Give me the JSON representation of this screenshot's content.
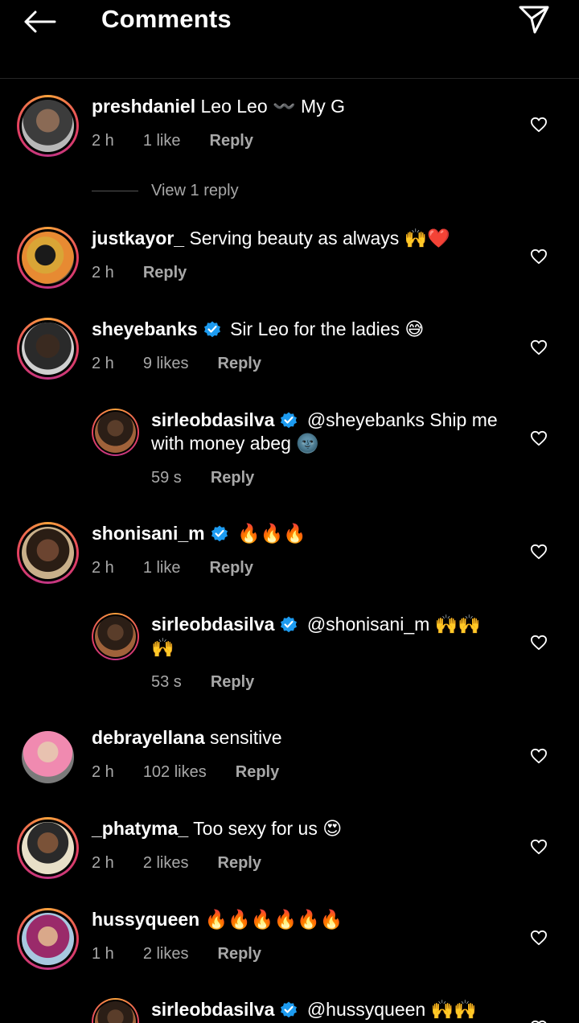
{
  "header": {
    "title": "Comments"
  },
  "colors": {
    "background": "#000000",
    "secondary_text": "#a8a8a8",
    "verified_blue": "#1d9bf0"
  },
  "comments": [
    {
      "user": "preshdaniel",
      "text": "Leo Leo 〰️ My G",
      "time": "2 h",
      "likes": "1 like",
      "reply_label": "Reply",
      "view_replies": "View 1 reply"
    },
    {
      "user": "justkayor_",
      "text": "Serving beauty as always 🙌❤️",
      "time": "2 h",
      "likes": "",
      "reply_label": "Reply"
    },
    {
      "user": "sheyebanks",
      "text": "Sir Leo for the ladies 😅",
      "time": "2 h",
      "likes": "9 likes",
      "reply_label": "Reply"
    },
    {
      "user": "sirleobdasilva",
      "text": "@sheyebanks Ship me with money abeg 🌚",
      "time": "59 s",
      "reply_label": "Reply"
    },
    {
      "user": "shonisani_m",
      "text": "🔥🔥🔥",
      "time": "2 h",
      "likes": "1 like",
      "reply_label": "Reply"
    },
    {
      "user": "sirleobdasilva",
      "text": "@shonisani_m 🙌🙌 🙌",
      "time": "53 s",
      "reply_label": "Reply"
    },
    {
      "user": "debrayellana",
      "text": "sensitive",
      "time": "2 h",
      "likes": "102 likes",
      "reply_label": "Reply"
    },
    {
      "user": "_phatyma_",
      "text": "Too sexy for us 😍",
      "time": "2 h",
      "likes": "2 likes",
      "reply_label": "Reply"
    },
    {
      "user": "hussyqueen",
      "text": "🔥🔥🔥🔥🔥🔥",
      "time": "1 h",
      "likes": "2 likes",
      "reply_label": "Reply"
    },
    {
      "user": "sirleobdasilva",
      "text": "@hussyqueen 🙌🙌"
    }
  ]
}
